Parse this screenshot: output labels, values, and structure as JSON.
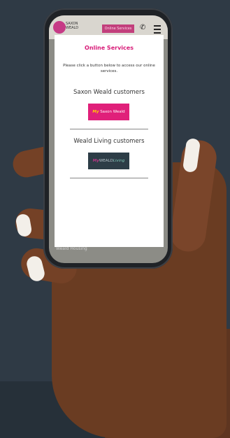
{
  "site": {
    "logo_text": "SAXON WEALD",
    "online_button": "Online Services",
    "footer_text": "Weald Housing"
  },
  "modal": {
    "title": "Online Services",
    "description": "Please click a button below to access our online services.",
    "sections": [
      {
        "heading": "Saxon Weald customers",
        "button": {
          "prefix": "My",
          "label": "Saxon Weald"
        }
      },
      {
        "heading": "Weald Living customers",
        "button": {
          "prefix": "My",
          "label": "WEALD",
          "suffix": "Living"
        }
      }
    ]
  },
  "colors": {
    "accent_pink": "#d81b78",
    "saxon_button": "#e0207a",
    "weald_button": "#2d3d47",
    "background": "#2f3a45"
  }
}
